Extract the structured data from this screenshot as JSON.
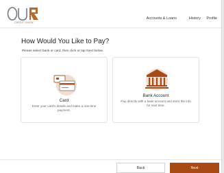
{
  "brand": {
    "name": "OUR",
    "tagline": "CREDIT UNION",
    "colors": {
      "accent": "#a84a15",
      "logo_letters": "#6f7a83",
      "logo_mark": "#b3692f"
    }
  },
  "nav": {
    "items": [
      {
        "label": "Accounts & Loans"
      },
      {
        "label": "History"
      },
      {
        "label": "Profile"
      }
    ]
  },
  "page": {
    "title": "How Would You Like to Pay?",
    "subtitle": "Please select bank or card, then click or tap Next below."
  },
  "options": [
    {
      "title": "Card",
      "description": "Enter your card's details and make a one-time payment.",
      "icon": "credit-card-icon"
    },
    {
      "title": "Bank Account",
      "description": "Pay directly with a bank account and store the info for next time.",
      "icon": "bank-icon"
    }
  ],
  "footer": {
    "back_label": "Back",
    "next_label": "Next"
  }
}
